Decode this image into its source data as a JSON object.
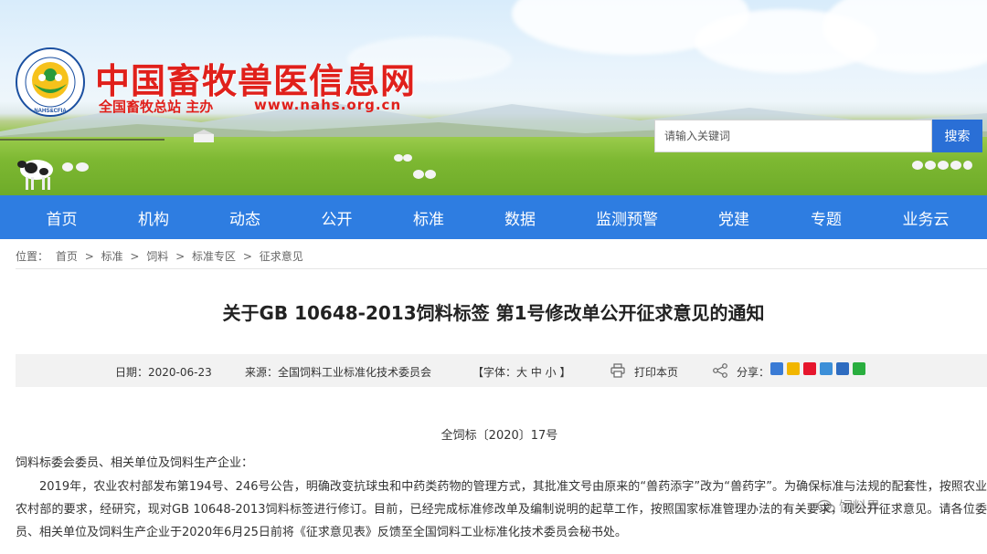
{
  "header": {
    "site_title": "中国畜牧兽医信息网",
    "subtitle": "全国畜牧总站 主办",
    "url": "www.nahs.org.cn",
    "logo_text": "NAHS&CFIA",
    "search_placeholder": "请输入关键词",
    "search_button": "搜索"
  },
  "nav": {
    "items": [
      "首页",
      "机构",
      "动态",
      "公开",
      "标准",
      "数据",
      "监测预警",
      "党建",
      "专题",
      "业务云"
    ]
  },
  "breadcrumb": {
    "prefix": "位置：",
    "items": [
      "首页",
      "标准",
      "饲料",
      "标准专区",
      "征求意见"
    ],
    "separator": ">"
  },
  "article": {
    "title": "关于GB 10648-2013饲料标签 第1号修改单公开征求意见的通知",
    "meta": {
      "date": "日期：2020-06-23",
      "source": "来源：全国饲料工业标准化技术委员会",
      "font_size": "【字体：大  中  小 】",
      "print": "打印本页",
      "share": "分享："
    },
    "doc_number": "全饲标〔2020〕17号",
    "salutation": "饲料标委会委员、相关单位及饲料生产企业：",
    "paragraph": "2019年，农业农村部发布第194号、246号公告，明确改变抗球虫和中药类药物的管理方式，其批准文号由原来的“兽药添字”改为“兽药字”。为确保标准与法规的配套性，按照农业农村部的要求，经研究，现对GB 10648-2013饲料标签进行修订。目前，已经完成标准修改单及编制说明的起草工作，按照国家标准管理办法的有关要求，现公开征求意见。请各位委员、相关单位及饲料生产企业于2020年6月25日前将《征求意见表》反馈至全国饲料工业标准化技术委员会秘书处。"
  },
  "watermark": "饲料界",
  "colors": {
    "brand_red": "#e0201b",
    "nav_blue": "#2e7de1",
    "search_blue": "#2a6fd6"
  }
}
